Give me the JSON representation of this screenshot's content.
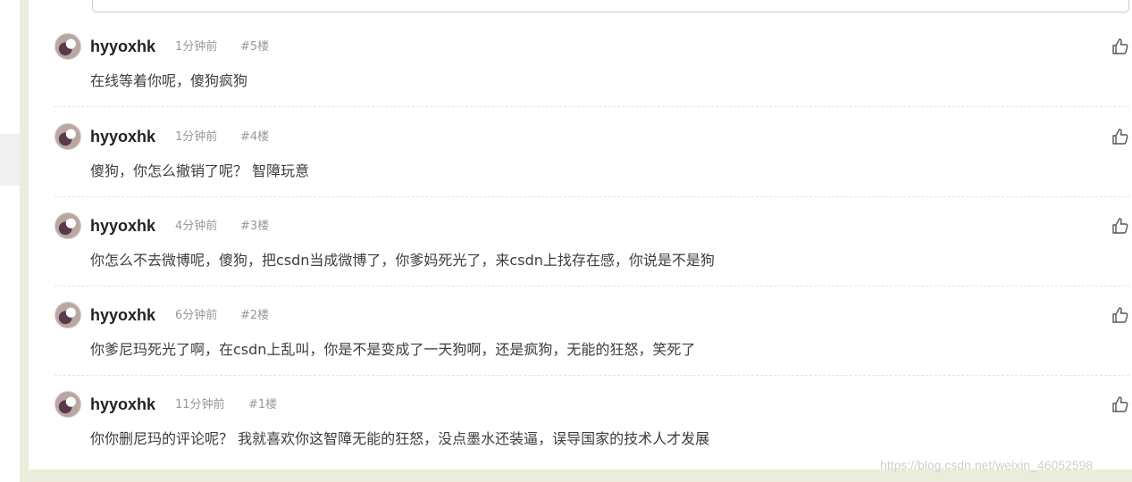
{
  "comments": [
    {
      "username": "hyyoxhk",
      "time": "1分钟前",
      "floor": "#5楼",
      "content": "在线等着你呢，傻狗疯狗",
      "like_icon": "thumbs-up-icon"
    },
    {
      "username": "hyyoxhk",
      "time": "1分钟前",
      "floor": "#4楼",
      "content": "傻狗，你怎么撤销了呢？ 智障玩意",
      "like_icon": "thumbs-up-icon"
    },
    {
      "username": "hyyoxhk",
      "time": "4分钟前",
      "floor": "#3楼",
      "content": "你怎么不去微博呢，傻狗，把csdn当成微博了，你爹妈死光了，来csdn上找存在感，你说是不是狗",
      "like_icon": "thumbs-up-icon"
    },
    {
      "username": "hyyoxhk",
      "time": "6分钟前",
      "floor": "#2楼",
      "content": "你爹尼玛死光了啊，在csdn上乱叫，你是不是变成了一天狗啊，还是疯狗，无能的狂怒，笑死了",
      "like_icon": "thumbs-up-icon"
    },
    {
      "username": "hyyoxhk",
      "time": "11分钟前",
      "floor": "#1楼",
      "content": "你你删尼玛的评论呢？ 我就喜欢你这智障无能的狂怒，没点墨水还装逼，误导国家的技术人才发展",
      "like_icon": "thumbs-up-icon"
    }
  ],
  "watermark": "https://blog.csdn.net/weixin_46052598",
  "colors": {
    "username": "#222222",
    "meta": "#999999",
    "content": "#3d3d3d",
    "side_strip": "#ececdc",
    "left_link": "#4a90c8"
  }
}
